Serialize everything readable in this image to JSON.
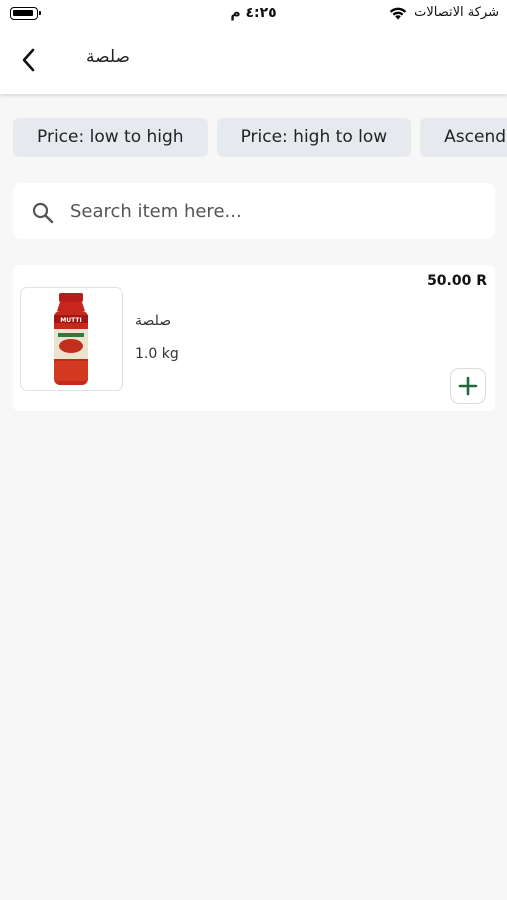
{
  "status_bar": {
    "time": "٤:٢٥ م",
    "carrier": "شركة الاتصالات"
  },
  "header": {
    "title": "صلصة"
  },
  "filters": [
    {
      "label": "Price: low to high"
    },
    {
      "label": "Price: high to low"
    },
    {
      "label": "Ascending"
    }
  ],
  "search": {
    "placeholder": "Search item here..."
  },
  "products": [
    {
      "name": "صلصة",
      "weight": "1.0 kg",
      "price": "50.00 R",
      "image": "tomato-sauce-jar"
    }
  ],
  "colors": {
    "accent": "#1f6b3a",
    "chip_bg": "#e6eaee",
    "page_bg": "#f7f7f7"
  }
}
